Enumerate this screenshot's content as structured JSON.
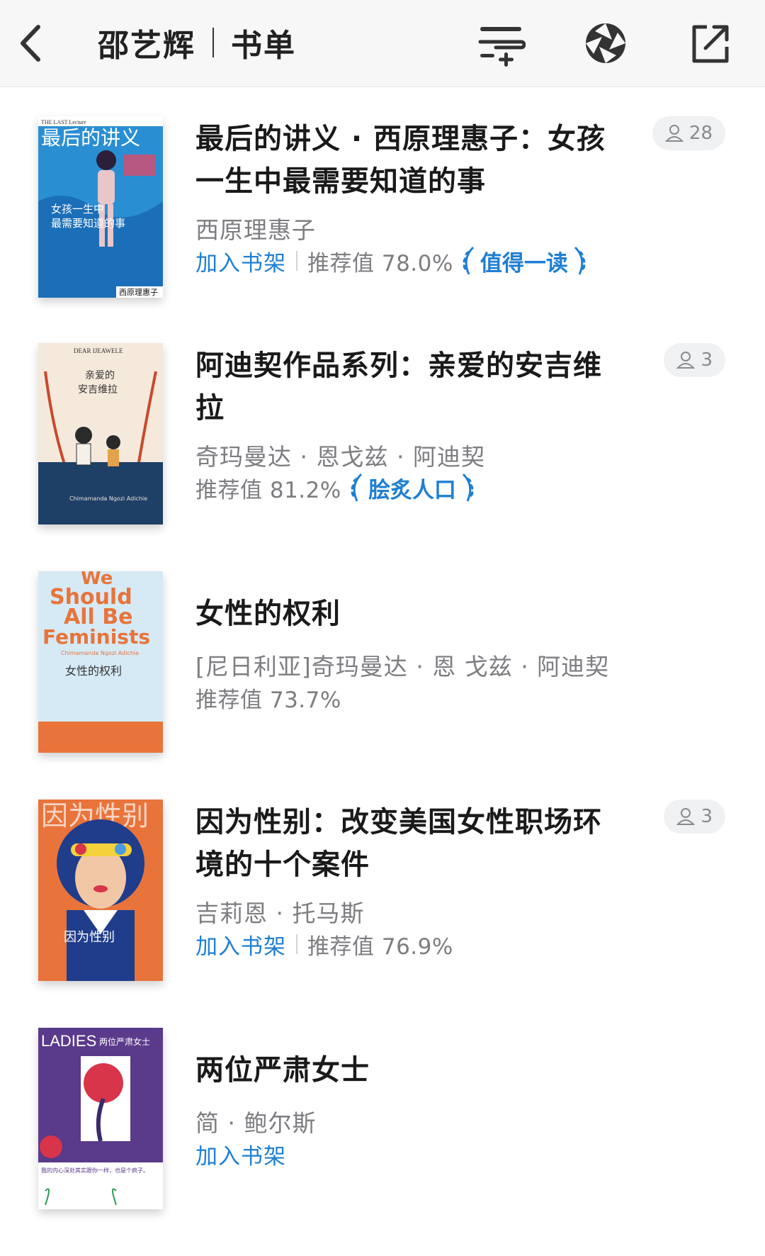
{
  "header": {
    "name": "邵艺辉",
    "title": "书单",
    "icons": [
      "back-icon",
      "list-add-icon",
      "aperture-icon",
      "share-icon"
    ]
  },
  "books": [
    {
      "title": "最后的讲义 · 西原理惠子：女孩一生中最需要知道的事",
      "author": "西原理惠子",
      "shelf": "加入书架",
      "score": "推荐值 78.0%",
      "badge": "值得一读",
      "readers": "28",
      "cover": {
        "top_text": "最后的讲义",
        "mid_text": "女孩一生中 最需要知道的事",
        "small_top": "THE LAST Lecture",
        "bottom": "西原理惠子",
        "bg": "#2a8fd2"
      }
    },
    {
      "title": "阿迪契作品系列：亲爱的安吉维拉",
      "author": "奇玛曼达 · 恩戈兹 · 阿迪契",
      "shelf": "",
      "score": "推荐值 81.2%",
      "badge": "脍炙人口",
      "readers": "3",
      "cover": {
        "small_top": "DEAR IJEAWELE",
        "mid_text": "亲爱的 安吉维拉",
        "bottom": "Chimamanda Ngozi Adichie",
        "bg": "#f3e6d6"
      }
    },
    {
      "title": "女性的权利",
      "author": "[尼日利亚]奇玛曼达 · 恩 戈兹 · 阿迪契",
      "shelf": "",
      "score": "推荐值 73.7%",
      "badge": "",
      "readers": "",
      "cover": {
        "top_text": "We Should All Be Feminists",
        "small_top": "Chimamanda Ngozi Adichie",
        "mid_text": "女性的权利",
        "bg": "#cfe6f3"
      }
    },
    {
      "title": "因为性别：改变美国女性职场环境的十个案件",
      "author": "吉莉恩 · 托马斯",
      "shelf": "加入书架",
      "score": "推荐值 76.9%",
      "badge": "",
      "readers": "3",
      "cover": {
        "top_text": "因为性别",
        "mid_text": "因为性别",
        "bg": "#e8743b"
      }
    },
    {
      "title": "两位严肃女士",
      "author": "简 · 鲍尔斯",
      "shelf": "加入书架",
      "score": "",
      "badge": "",
      "readers": "",
      "cover": {
        "top_text": "LADIES",
        "mid_text": "两位严肃女士",
        "bottom": "我的内心深处其实跟你一样，也是个疯子。",
        "bg": "#5a3a8a"
      }
    }
  ]
}
